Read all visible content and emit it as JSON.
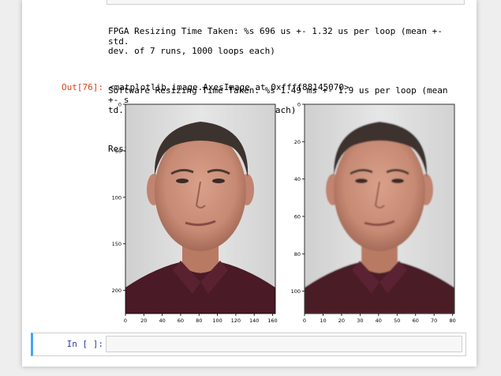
{
  "output": {
    "stream_lines": [
      "FPGA Resizing Time Taken: %s 696 us +- 1.32 us per loop (mean +- std.\ndev. of 7 runs, 1000 loops each)",
      "Software Resizing Time Taken: %s 1.49 ms +- 1.9 us per loop (mean +- s\ntd. dev. of 7 runs, 1000 loops each)",
      "Resizing Factor is 2"
    ],
    "out_prompt": "Out[76]:",
    "repr": "<matplotlib.image.AxesImage at 0xffff88145070>"
  },
  "figures": [
    {
      "image": "portrait of a man in a maroon polo shirt (original resolution)",
      "xticks": [
        "0",
        "20",
        "40",
        "60",
        "80",
        "100",
        "120",
        "140",
        "160"
      ],
      "yticks": [
        "0",
        "50",
        "100",
        "150",
        "200"
      ]
    },
    {
      "image": "portrait of a man in a maroon polo shirt (resized, factor 2)",
      "xticks": [
        "0",
        "10",
        "20",
        "30",
        "40",
        "50",
        "60",
        "70",
        "80"
      ],
      "yticks": [
        "0",
        "20",
        "40",
        "60",
        "80",
        "100"
      ]
    }
  ],
  "input": {
    "prompt": "In [ ]:",
    "value": ""
  },
  "colors": {
    "out_prompt": "#d84315",
    "in_prompt": "#303f9f",
    "cell_accent": "#42a5f5",
    "shirt": "#4a1a26",
    "background": "#dcdcdc"
  }
}
